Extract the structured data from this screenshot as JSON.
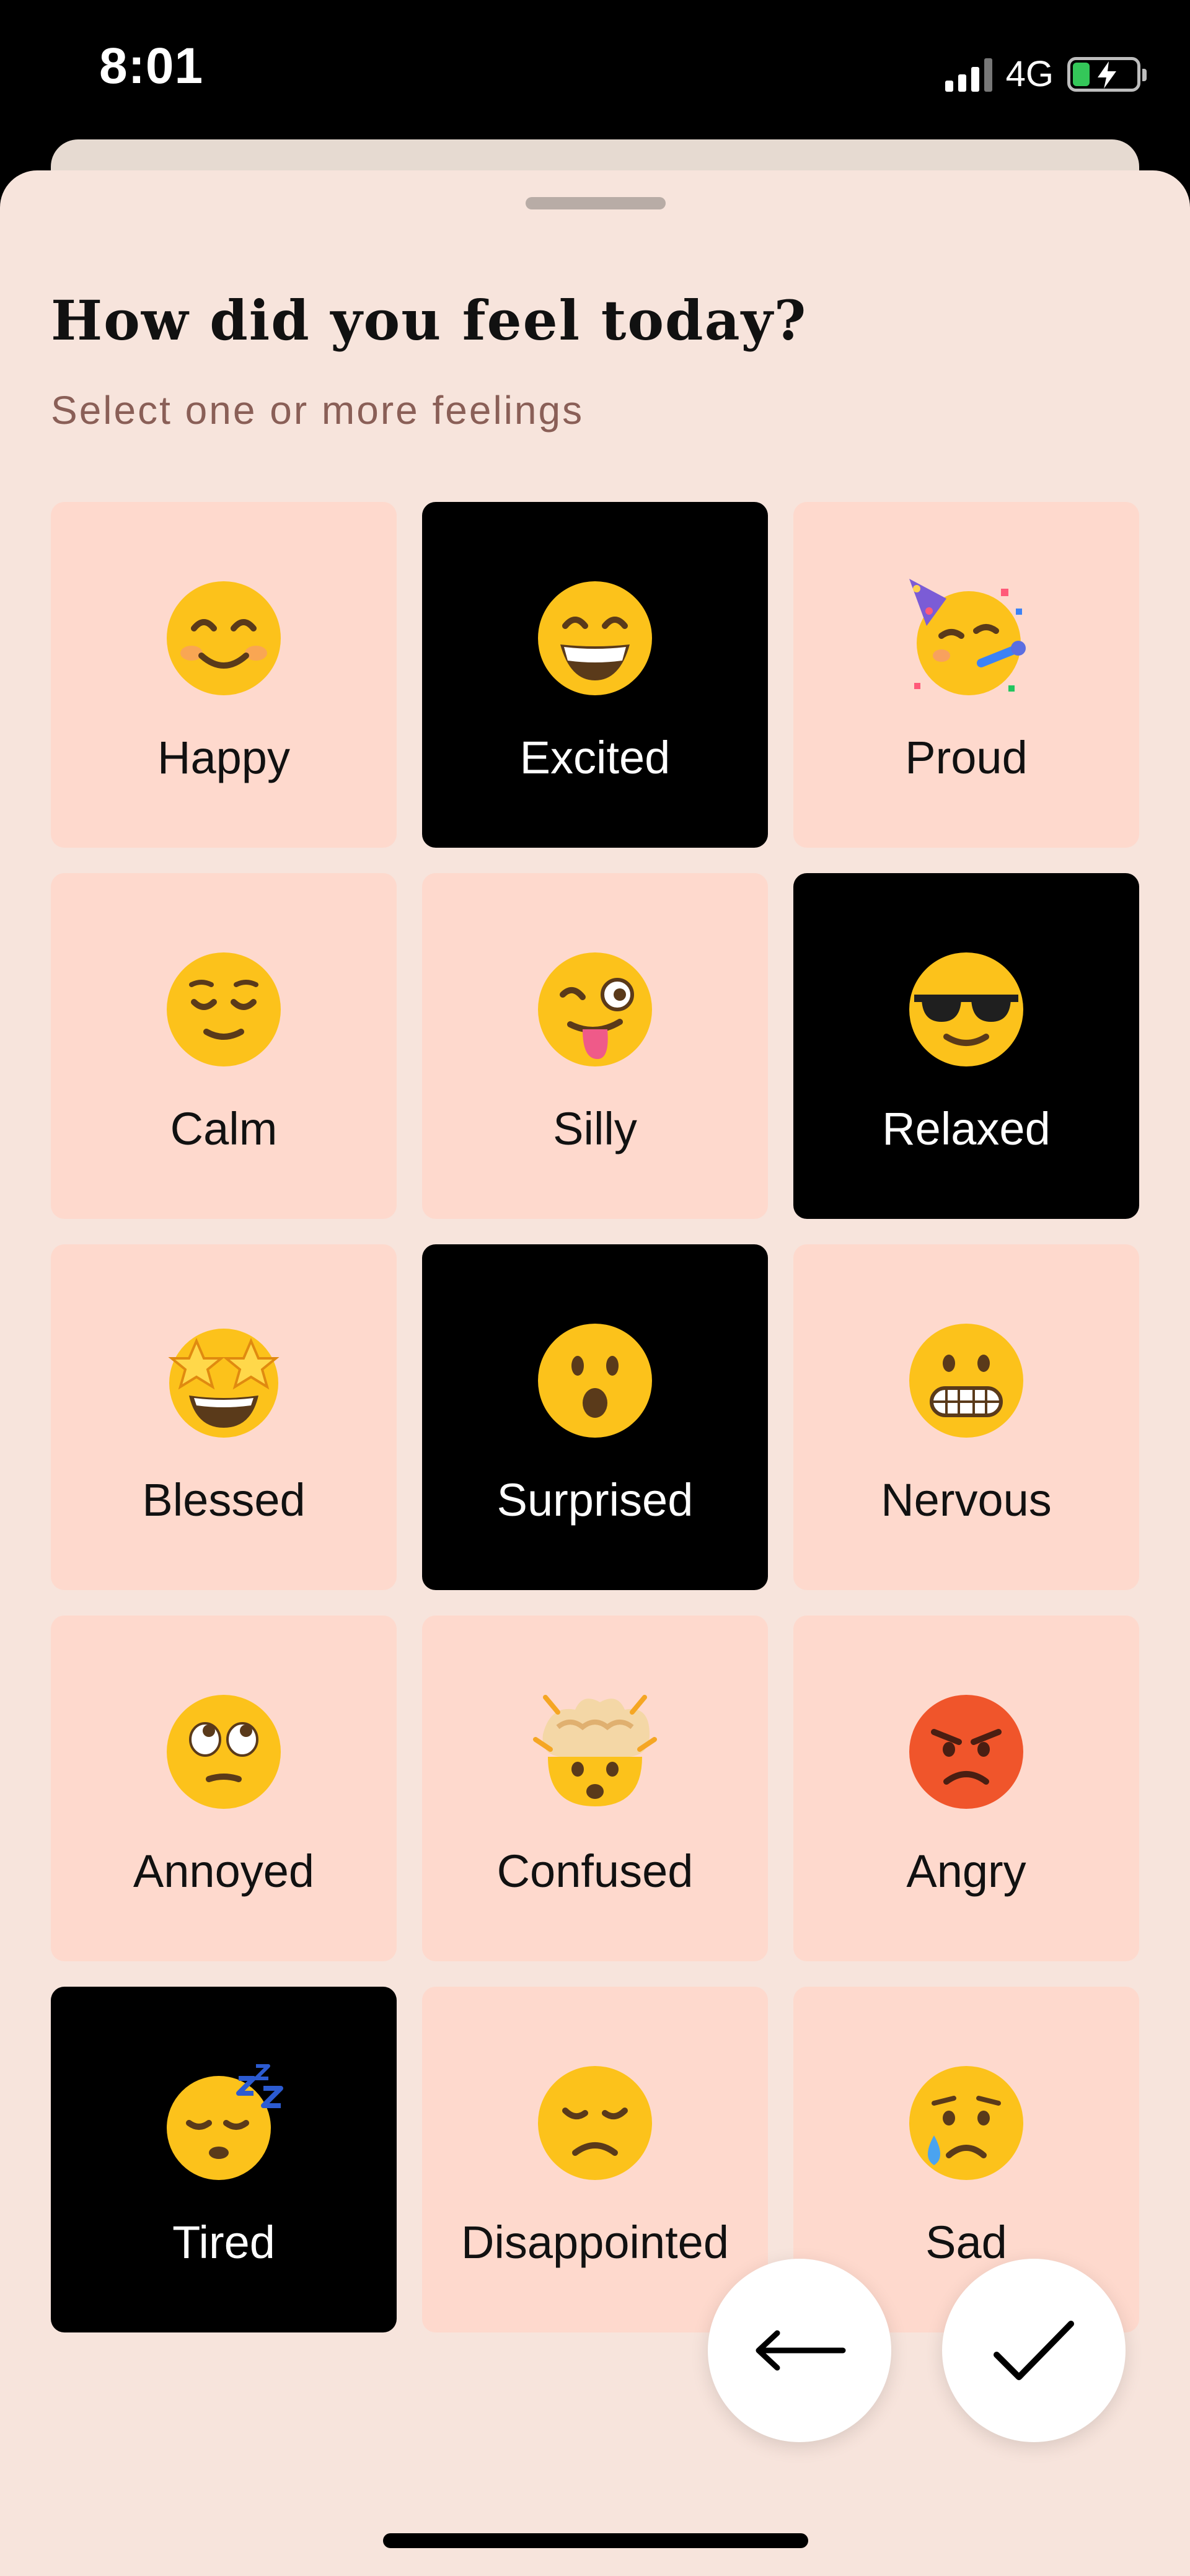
{
  "status_bar": {
    "time": "8:01",
    "network": "4G",
    "battery_level": 0.25,
    "battery_color": "#34c759"
  },
  "header": {
    "title": "How did you feel today?",
    "subtitle": "Select one or more feelings"
  },
  "feelings": [
    {
      "label": "Happy",
      "emoji": "smiling-face-icon",
      "selected": false
    },
    {
      "label": "Excited",
      "emoji": "grinning-face-icon",
      "selected": true
    },
    {
      "label": "Proud",
      "emoji": "partying-face-icon",
      "selected": false
    },
    {
      "label": "Calm",
      "emoji": "relieved-face-icon",
      "selected": false
    },
    {
      "label": "Silly",
      "emoji": "winking-tongue-face-icon",
      "selected": false
    },
    {
      "label": "Relaxed",
      "emoji": "sunglasses-face-icon",
      "selected": true
    },
    {
      "label": "Blessed",
      "emoji": "star-struck-face-icon",
      "selected": false
    },
    {
      "label": "Surprised",
      "emoji": "hushed-face-icon",
      "selected": true
    },
    {
      "label": "Nervous",
      "emoji": "grimacing-face-icon",
      "selected": false
    },
    {
      "label": "Annoyed",
      "emoji": "eye-roll-face-icon",
      "selected": false
    },
    {
      "label": "Confused",
      "emoji": "exploding-head-icon",
      "selected": false
    },
    {
      "label": "Angry",
      "emoji": "angry-face-icon",
      "selected": false
    },
    {
      "label": "Tired",
      "emoji": "sleeping-face-icon",
      "selected": true
    },
    {
      "label": "Disappointed",
      "emoji": "disappointed-face-icon",
      "selected": false
    },
    {
      "label": "Sad",
      "emoji": "crying-face-icon",
      "selected": false
    }
  ],
  "actions": {
    "back_icon": "arrow-left-icon",
    "confirm_icon": "checkmark-icon"
  },
  "colors": {
    "sheet_background": "#f7e4dc",
    "card_background": "#fed9cd",
    "card_selected": "#000000",
    "subtitle": "#8a5f57"
  }
}
